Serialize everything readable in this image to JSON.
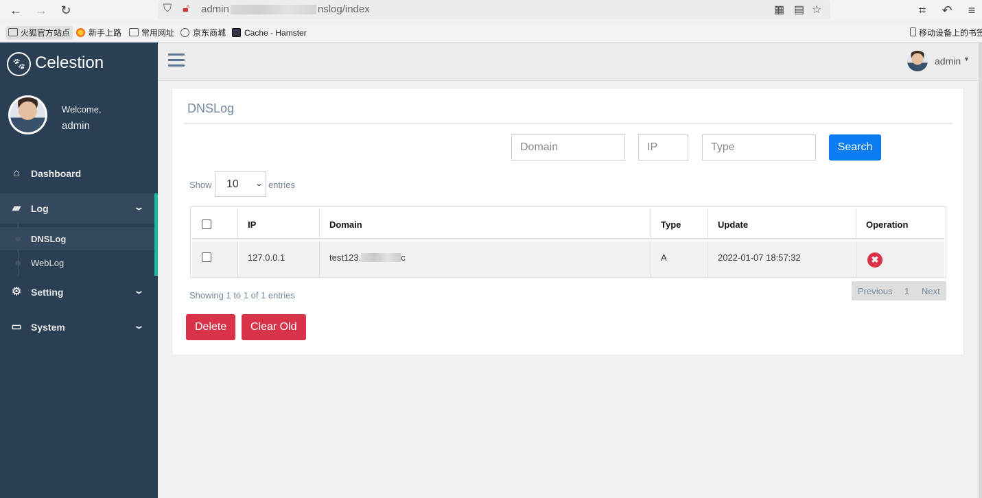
{
  "browser": {
    "url_prefix": "admin",
    "url_suffix": "nslog/index",
    "bookmarks": [
      "火狐官方站点",
      "新手上路",
      "常用网址",
      "京东商城",
      "Cache - Hamster"
    ],
    "mobile_bookmarks": "移动设备上的书签"
  },
  "app": {
    "brand": "Celestion",
    "welcome": "Welcome,",
    "user": "admin"
  },
  "sidebar": {
    "items": [
      {
        "label": "Dashboard",
        "icon": "home-icon"
      },
      {
        "label": "Log",
        "icon": "book-icon",
        "expanded": true
      },
      {
        "label": "Setting",
        "icon": "gear-icon"
      },
      {
        "label": "System",
        "icon": "laptop-icon"
      }
    ],
    "log_sub": [
      {
        "label": "DNSLog",
        "current": true
      },
      {
        "label": "WebLog"
      }
    ]
  },
  "topbar": {
    "user": "admin"
  },
  "panel": {
    "title": "DNSLog",
    "search": {
      "domain_placeholder": "Domain",
      "ip_placeholder": "IP",
      "type_placeholder": "Type",
      "button": "Search"
    },
    "length": {
      "show": "Show",
      "value": "10",
      "entries": "entries"
    },
    "table": {
      "headers": [
        "IP",
        "Domain",
        "Type",
        "Update",
        "Operation"
      ],
      "rows": [
        {
          "ip": "127.0.0.1",
          "domain": "test123.",
          "domain_tail": "c",
          "type": "A",
          "update": "2022-01-07 18:57:32"
        }
      ]
    },
    "info": "Showing 1 to 1 of 1 entries",
    "pager": {
      "previous": "Previous",
      "page": "1",
      "next": "Next"
    },
    "actions": {
      "delete": "Delete",
      "clear_old": "Clear Old"
    }
  },
  "colors": {
    "sidebar": "#2a3f54",
    "accent": "#1abb9c",
    "primary": "#0d7cf2",
    "danger": "#d9334a"
  }
}
